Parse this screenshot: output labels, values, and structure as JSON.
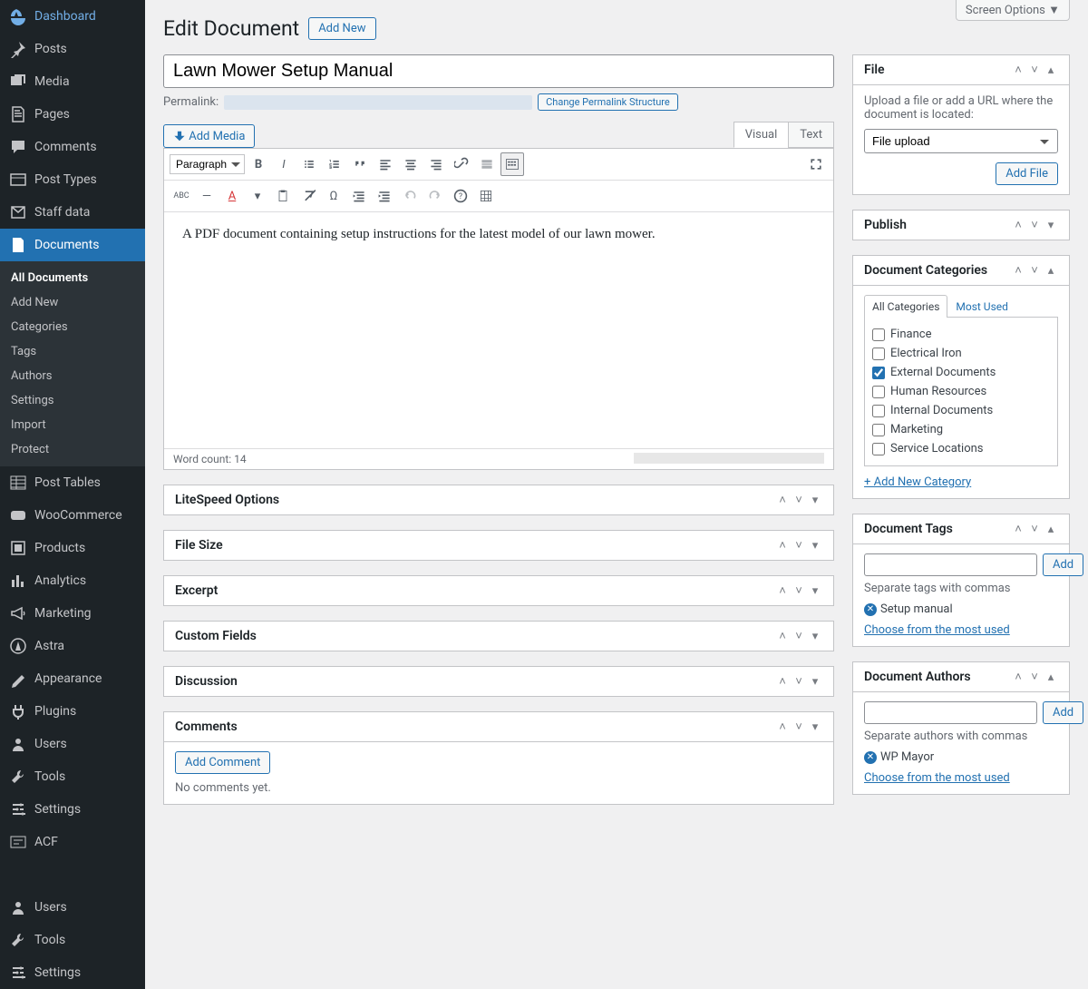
{
  "screen_options": "Screen Options",
  "page_title": "Edit Document",
  "add_new": "Add New",
  "sidebar": [
    {
      "icon": "dashboard",
      "label": "Dashboard"
    },
    {
      "icon": "pin",
      "label": "Posts"
    },
    {
      "icon": "media",
      "label": "Media"
    },
    {
      "icon": "page",
      "label": "Pages"
    },
    {
      "icon": "comment",
      "label": "Comments"
    },
    {
      "icon": "posttypes",
      "label": "Post Types"
    },
    {
      "icon": "staff",
      "label": "Staff data"
    },
    {
      "icon": "document",
      "label": "Documents",
      "active": true
    },
    {
      "icon": "posttables",
      "label": "Post Tables"
    },
    {
      "icon": "woo",
      "label": "WooCommerce"
    },
    {
      "icon": "products",
      "label": "Products"
    },
    {
      "icon": "analytics",
      "label": "Analytics"
    },
    {
      "icon": "marketing",
      "label": "Marketing"
    },
    {
      "icon": "astra",
      "label": "Astra"
    },
    {
      "icon": "appearance",
      "label": "Appearance"
    },
    {
      "icon": "plugins",
      "label": "Plugins"
    },
    {
      "icon": "users",
      "label": "Users"
    },
    {
      "icon": "tools",
      "label": "Tools"
    },
    {
      "icon": "settings",
      "label": "Settings"
    },
    {
      "icon": "acf",
      "label": "ACF"
    },
    {
      "icon": "item",
      "label": ""
    },
    {
      "icon": "users",
      "label": "Users"
    },
    {
      "icon": "tools",
      "label": "Tools"
    },
    {
      "icon": "settings",
      "label": "Settings"
    }
  ],
  "submenu": {
    "items": [
      "All Documents",
      "Add New",
      "Categories",
      "Tags",
      "Authors",
      "Settings",
      "Import",
      "Protect"
    ],
    "current": 0,
    "after_index": 7
  },
  "title_value": "Lawn Mower Setup Manual",
  "permalink_label": "Permalink:",
  "change_permalink": "Change Permalink Structure",
  "add_media": "Add Media",
  "tabs": {
    "visual": "Visual",
    "text": "Text"
  },
  "format_select": "Paragraph",
  "editor_body": "A PDF document containing setup instructions for the latest model of our lawn mower.",
  "word_count_label": "Word count: 14",
  "metaboxes": [
    "LiteSpeed Options",
    "File Size",
    "Excerpt",
    "Custom Fields",
    "Discussion"
  ],
  "comments_box": {
    "title": "Comments",
    "add_btn": "Add Comment",
    "empty": "No comments yet."
  },
  "file_box": {
    "title": "File",
    "desc": "Upload a file or add a URL where the document is located:",
    "select_value": "File upload",
    "add_btn": "Add File"
  },
  "publish_box": {
    "title": "Publish"
  },
  "cat_box": {
    "title": "Document Categories",
    "tab_all": "All Categories",
    "tab_most": "Most Used",
    "items": [
      {
        "label": "Finance",
        "checked": false
      },
      {
        "label": "Electrical Iron",
        "checked": false
      },
      {
        "label": "External Documents",
        "checked": true
      },
      {
        "label": "Human Resources",
        "checked": false
      },
      {
        "label": "Internal Documents",
        "checked": false
      },
      {
        "label": "Marketing",
        "checked": false
      },
      {
        "label": "Service Locations",
        "checked": false
      }
    ],
    "add_link": "+ Add New Category"
  },
  "tags_box": {
    "title": "Document Tags",
    "add_btn": "Add",
    "hint": "Separate tags with commas",
    "tag": "Setup manual",
    "most_used": "Choose from the most used"
  },
  "authors_box": {
    "title": "Document Authors",
    "add_btn": "Add",
    "hint": "Separate authors with commas",
    "author": "WP Mayor",
    "most_used": "Choose from the most used"
  }
}
